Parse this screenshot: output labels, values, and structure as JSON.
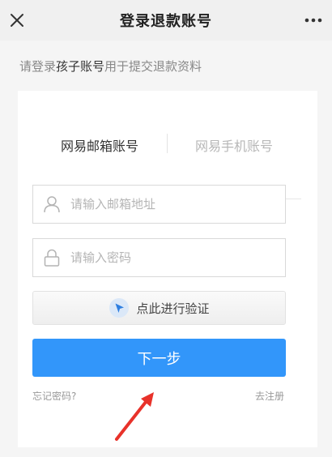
{
  "header": {
    "title": "登录退款账号",
    "close_icon": "close-icon",
    "more_icon": "more-icon"
  },
  "hint": {
    "prefix": "请登录",
    "emphasis": "孩子账号",
    "suffix": "用于提交退款资料"
  },
  "tabs": {
    "email": "网易邮箱账号",
    "phone": "网易手机账号",
    "active": "email"
  },
  "form": {
    "email_placeholder": "请输入邮箱地址",
    "password_placeholder": "请输入密码",
    "captcha_label": "点此进行验证",
    "next_label": "下一步",
    "forgot_label": "忘记密码?",
    "register_label": "去注册"
  },
  "colors": {
    "primary": "#3296fa",
    "tab_underline": "#4a90e2",
    "annotation_arrow": "#e8322a"
  }
}
